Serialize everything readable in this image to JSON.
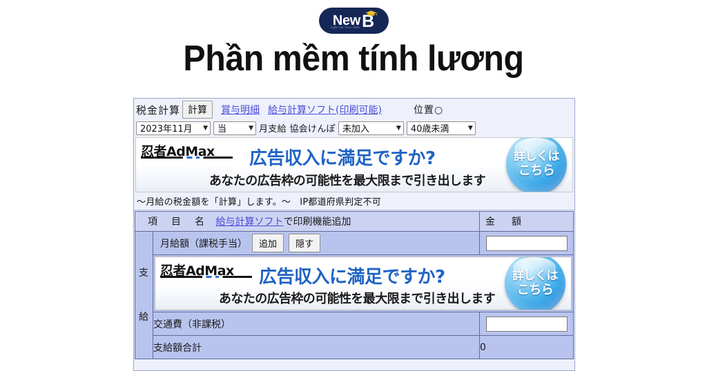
{
  "brand": {
    "logo_text": "New",
    "logo_letter": "B",
    "tagline": "Light Up Your Own",
    "icon": "graduation-cap-icon"
  },
  "page": {
    "title": "Phần mềm tính lương"
  },
  "app": {
    "toolbar": {
      "label": "税金計算",
      "calc_button": "計算",
      "link_bonus": "賞与明細",
      "link_software": "給与計算ソフト(印刷可能)",
      "position_label": "位置○"
    },
    "filters": {
      "month": "2023年11月",
      "timing": "当",
      "mid_text": "月支給 協会けんぽ",
      "enrollment": "未加入",
      "age": "40歳未満",
      "caret": "▼"
    },
    "ad": {
      "logo": "忍者AdMax",
      "headline": "広告収入に満足ですか?",
      "subtext": "あなたの広告枠の可能性を最大限まで引き出します",
      "cta_line1": "詳しくは",
      "cta_line2": "こちら"
    },
    "note": "〜月給の税金額を「計算」します。〜　IP都道府県判定不可",
    "table": {
      "header": {
        "name_col": "項　目　名",
        "name_link": "給与計算ソフト",
        "name_suffix": "で印刷機能追加",
        "amount_col": "金　額"
      },
      "side_label_1": "支",
      "side_label_2": "給",
      "rows": [
        {
          "label": "月給額（課税手当）",
          "add_button": "追加",
          "hide_button": "隠す",
          "value": ""
        },
        {
          "label": "交通費（非課税）",
          "value": ""
        },
        {
          "label": "支給額合計",
          "value": "0"
        }
      ]
    }
  },
  "colors": {
    "brand_navy": "#152756",
    "table_row": "#b9c4ee",
    "table_header": "#ccd3f2",
    "app_bg": "#eef1fc",
    "link": "#4b4bd6",
    "ad_blue": "#1f63c4"
  }
}
